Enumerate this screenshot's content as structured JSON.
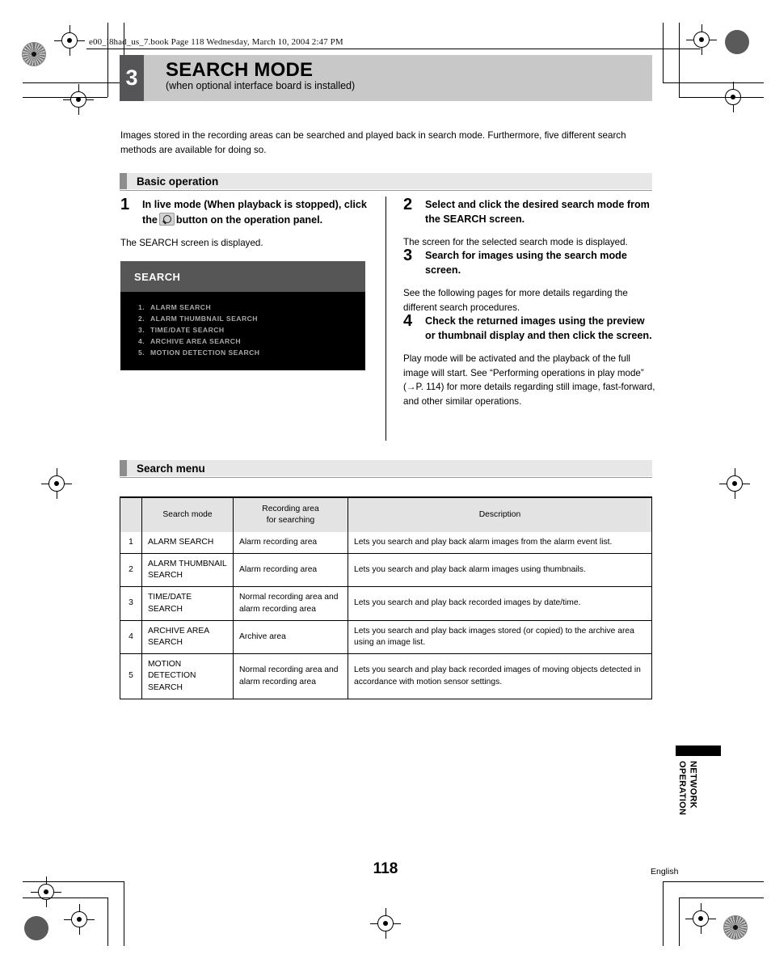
{
  "print_marks": {
    "file_slug": "e00_l8had_us_7.book  Page 118  Wednesday, March 10, 2004  2:47 PM"
  },
  "chapter": {
    "number": "3",
    "title": "SEARCH MODE",
    "subtitle": "(when optional interface board is installed)"
  },
  "intro": "Images stored in the recording areas can be searched and played back in search mode. Furthermore, five different search methods are available for doing so.",
  "sections": {
    "basic_operation": "Basic operation",
    "search_menu": "Search menu"
  },
  "steps_left": [
    {
      "num": "1",
      "text_before_icon": "In live mode (When playback is stopped), click the",
      "icon": "magnifier-icon",
      "text_after_icon": "button on the operation panel.",
      "note": "The SEARCH screen is displayed."
    }
  ],
  "device_screen": {
    "title": "SEARCH",
    "items": [
      {
        "index": "1.",
        "label": "ALARM SEARCH"
      },
      {
        "index": "2.",
        "label": "ALARM THUMBNAIL SEARCH"
      },
      {
        "index": "3.",
        "label": "TIME/DATE SEARCH"
      },
      {
        "index": "4.",
        "label": "ARCHIVE AREA SEARCH"
      },
      {
        "index": "5.",
        "label": "MOTION DETECTION SEARCH"
      }
    ]
  },
  "steps_right": [
    {
      "num": "2",
      "text": "Select and click the desired search mode from the SEARCH screen.",
      "note": "The screen for the selected search mode is displayed."
    },
    {
      "num": "3",
      "text": "Search for images using the search mode screen.",
      "note": "See the following pages for more details regarding the different search procedures."
    },
    {
      "num": "4",
      "text": "Check the returned images using the preview or thumbnail display and then click the screen.",
      "note": "Play mode will be activated and the playback of the full image will start. See “Performing operations in play mode” (→P. 114) for more details regarding still image, fast-forward, and other similar operations."
    }
  ],
  "table": {
    "headers": {
      "index": "",
      "mode": "Search mode",
      "area_line1": "Recording area",
      "area_line2": "for searching",
      "description": "Description"
    },
    "rows": [
      {
        "index": "1",
        "mode": "ALARM SEARCH",
        "area": "Alarm recording area",
        "description": "Lets you search and play back alarm images from the alarm event list."
      },
      {
        "index": "2",
        "mode": "ALARM THUMBNAIL SEARCH",
        "area": "Alarm recording area",
        "description": "Lets you search and play back alarm images using thumbnails."
      },
      {
        "index": "3",
        "mode": "TIME/DATE SEARCH",
        "area": "Normal recording area and alarm recording area",
        "description": "Lets you search and play back recorded images by date/time."
      },
      {
        "index": "4",
        "mode": "ARCHIVE AREA SEARCH",
        "area": "Archive area",
        "description": "Lets you search and play back images stored (or copied) to the archive area using an image list."
      },
      {
        "index": "5",
        "mode": "MOTION DETECTION SEARCH",
        "area": "Normal recording area and alarm recording area",
        "description": "Lets you search and play back recorded images of moving objects detected in accordance with motion sensor settings."
      }
    ]
  },
  "thumb_tab": {
    "label": "NETWORK\nOPERATION"
  },
  "footer": {
    "page_number": "118",
    "language": "English"
  },
  "colors": {
    "chapter_number_bg": "#555557",
    "chapter_title_bg": "#c8c8c8",
    "section_tick": "#8d8d8d",
    "section_bg": "#e7e7e7",
    "device_header_bg": "#565656",
    "device_body_bg": "#000000",
    "device_item_text": "#a9a9a9",
    "table_header_bg": "#e3e3e3"
  }
}
